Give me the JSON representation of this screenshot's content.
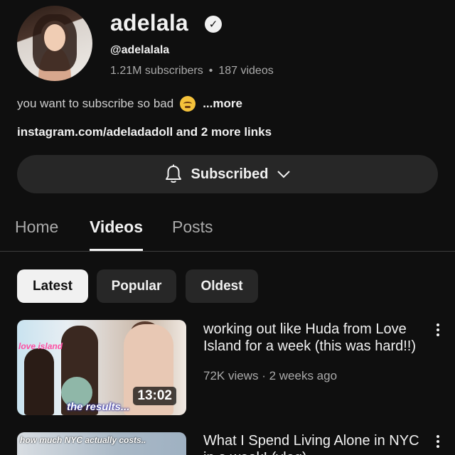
{
  "channel": {
    "name": "adelala",
    "handle": "@adelalala",
    "subscribers": "1.21M subscribers",
    "separator": "•",
    "videos": "187 videos",
    "description": "you want to subscribe so bad",
    "more_label": "...more",
    "links": "instagram.com/adeladadoll and 2 more links",
    "verified_icon": "check-circle-icon"
  },
  "subscribe_button": {
    "label": "Subscribed",
    "bell_icon": "bell-icon",
    "chevron_icon": "chevron-down-icon"
  },
  "tabs": [
    {
      "label": "Home"
    },
    {
      "label": "Videos",
      "active": true
    },
    {
      "label": "Posts"
    }
  ],
  "chips": [
    {
      "label": "Latest",
      "active": true
    },
    {
      "label": "Popular"
    },
    {
      "label": "Oldest"
    }
  ],
  "videos": [
    {
      "title": "working out like Huda from Love Island for a week (this was hard!!)",
      "meta": "72K views · 2 weeks ago",
      "duration": "13:02",
      "thumb_overlay_top": "love island",
      "thumb_caption": "the results..."
    },
    {
      "title": "What I Spend Living Alone in NYC in a week! (vlog)",
      "thumb_caption": "how much NYC actually costs.."
    }
  ],
  "colors": {
    "background": "#0f0f0f",
    "chip_bg": "#272727",
    "text_secondary": "#aaaaaa"
  }
}
